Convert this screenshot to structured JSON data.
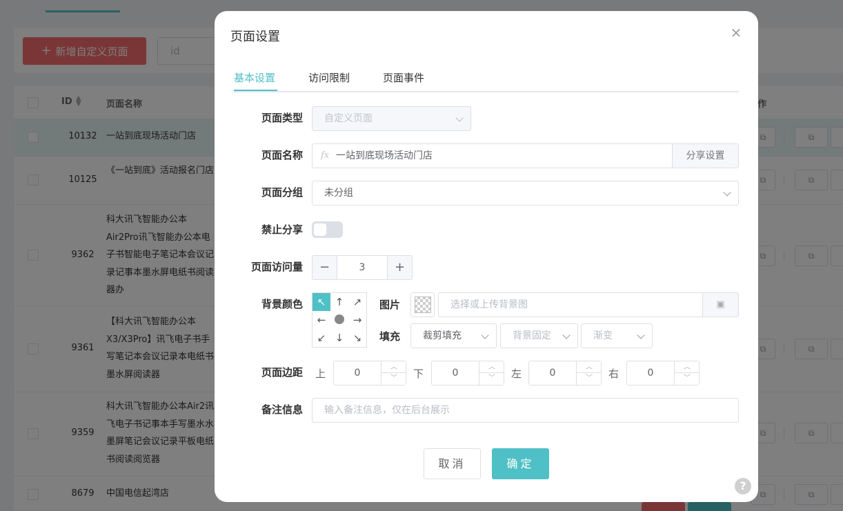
{
  "background": {
    "new_page_button": "新增自定义页面",
    "search_placeholder": "id",
    "columns": {
      "id": "ID",
      "name": "页面名称",
      "ops_partial": "作"
    },
    "rows": [
      {
        "id": "10132",
        "name": "一站到底现场活动门店"
      },
      {
        "id": "10125",
        "name": "《一站到底》活动报名门店"
      },
      {
        "id": "9362",
        "name": "科大讯飞智能办公本Air2Pro讯飞智能办公本电子书智能电子笔记本会议记录记事本墨水屏电纸书阅读器办"
      },
      {
        "id": "9361",
        "name": "【科大讯飞智能办公本X3/X3Pro】讯飞电子书手写笔记本会议记录本电纸书墨水屏阅读器"
      },
      {
        "id": "9359",
        "name": "科大讯飞智能办公本Air2讯飞电子书记事本手写墨水水墨屏笔记会议记录平板电纸书阅读阅览器"
      },
      {
        "id": "8679",
        "name": "中国电信起湾店"
      }
    ]
  },
  "modal": {
    "title": "页面设置",
    "tabs": [
      "基本设置",
      "访问限制",
      "页面事件"
    ],
    "active_tab": "基本设置",
    "labels": {
      "page_type": "页面类型",
      "page_name": "页面名称",
      "page_group": "页面分组",
      "disable_share": "禁止分享",
      "page_views": "页面访问量",
      "bg_color": "背景颜色",
      "page_margin": "页面边距",
      "remark": "备注信息",
      "image": "图片",
      "fill": "填充"
    },
    "page_type_value": "自定义页面",
    "page_name_value": "一站到底现场活动门店",
    "fx_symbol": "fx",
    "share_settings_button": "分享设置",
    "page_group_value": "未分组",
    "disable_share_on": false,
    "page_views_value": "3",
    "position_arrows": [
      "↖",
      "↑",
      "↗",
      "←",
      "•",
      "→",
      "↙",
      "↓",
      "↘"
    ],
    "image_placeholder": "选择或上传背景图",
    "fill_options": {
      "fill_mode": "裁剪填充",
      "bg_fixed": "背景固定",
      "gradient": "渐变"
    },
    "margin": {
      "top_label": "上",
      "top_value": "0",
      "bottom_label": "下",
      "bottom_value": "0",
      "left_label": "左",
      "left_value": "0",
      "right_label": "右",
      "right_value": "0"
    },
    "remark_placeholder": "输入备注信息，仅在后台展示",
    "cancel_button": "取消",
    "ok_button": "确定",
    "minus": "−",
    "plus": "+",
    "close_glyph": "×",
    "help_glyph": "?",
    "colors": {
      "accent": "#4fc0c6",
      "danger": "#f56c6c"
    }
  }
}
